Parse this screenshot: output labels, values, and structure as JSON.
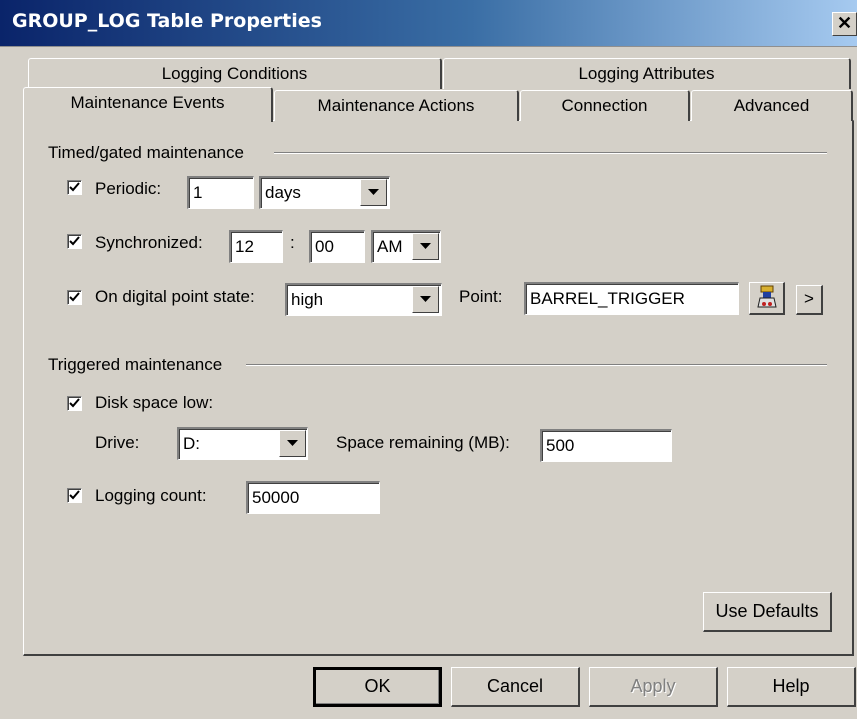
{
  "window": {
    "title": "GROUP_LOG Table Properties",
    "close_glyph": "✕"
  },
  "tabs": {
    "row1": [
      {
        "label": "Logging Conditions"
      },
      {
        "label": "Logging Attributes"
      }
    ],
    "row2": [
      {
        "label": "Maintenance Events",
        "active": true
      },
      {
        "label": "Maintenance Actions"
      },
      {
        "label": "Connection"
      },
      {
        "label": "Advanced"
      }
    ]
  },
  "timed": {
    "group_label": "Timed/gated maintenance",
    "periodic": {
      "label": "Periodic:",
      "checked": true,
      "value": "1",
      "unit": "days"
    },
    "synchronized": {
      "label": "Synchronized:",
      "checked": true,
      "hour": "12",
      "separator": ":",
      "minute": "00",
      "ampm": "AM"
    },
    "digital": {
      "label": "On digital point state:",
      "checked": true,
      "state": "high",
      "point_label": "Point:",
      "point_value": "BARREL_TRIGGER",
      "browse_icon": "point-browser-icon",
      "more_label": ">"
    }
  },
  "triggered": {
    "group_label": "Triggered maintenance",
    "disk_low": {
      "label": "Disk space low:",
      "checked": true,
      "drive_label": "Drive:",
      "drive_value": "D:",
      "space_label": "Space remaining (MB):",
      "space_value": "500"
    },
    "logging_count": {
      "label": "Logging count:",
      "checked": true,
      "value": "50000"
    }
  },
  "buttons": {
    "use_defaults": "Use Defaults",
    "ok": "OK",
    "cancel": "Cancel",
    "apply": "Apply",
    "help": "Help"
  },
  "colors": {
    "titlebar_start": "#0a246a",
    "titlebar_end": "#a6caf0",
    "face": "#d4d0c8"
  }
}
